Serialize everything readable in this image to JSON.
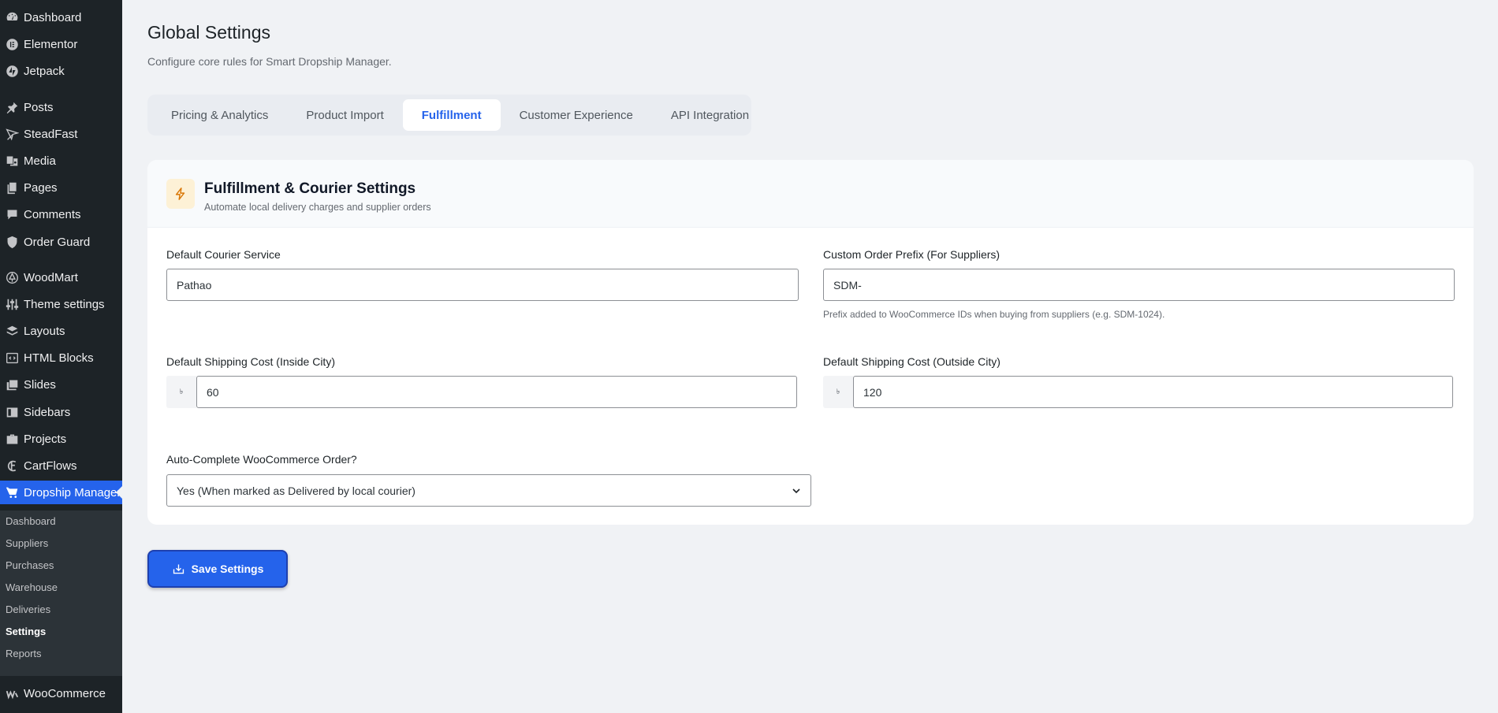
{
  "sidebar": {
    "items": [
      {
        "label": "Dashboard",
        "icon": "dashboard-icon"
      },
      {
        "label": "Elementor",
        "icon": "elementor-icon"
      },
      {
        "label": "Jetpack",
        "icon": "jetpack-icon"
      },
      {
        "label": "Posts",
        "icon": "pin-icon"
      },
      {
        "label": "SteadFast",
        "icon": "steadfast-icon"
      },
      {
        "label": "Media",
        "icon": "media-icon"
      },
      {
        "label": "Pages",
        "icon": "pages-icon"
      },
      {
        "label": "Comments",
        "icon": "comment-icon"
      },
      {
        "label": "Order Guard",
        "icon": "shield-icon"
      },
      {
        "label": "WoodMart",
        "icon": "woodmart-icon"
      },
      {
        "label": "Theme settings",
        "icon": "sliders-icon"
      },
      {
        "label": "Layouts",
        "icon": "layers-icon"
      },
      {
        "label": "HTML Blocks",
        "icon": "code-icon"
      },
      {
        "label": "Slides",
        "icon": "slides-icon"
      },
      {
        "label": "Sidebars",
        "icon": "sidebar-icon"
      },
      {
        "label": "Projects",
        "icon": "briefcase-icon"
      },
      {
        "label": "CartFlows",
        "icon": "cartflows-icon"
      },
      {
        "label": "Dropship Manager",
        "icon": "cart-icon"
      },
      {
        "label": "WooCommerce",
        "icon": "woocommerce-icon"
      }
    ],
    "submenu": [
      "Dashboard",
      "Suppliers",
      "Purchases",
      "Warehouse",
      "Deliveries",
      "Settings",
      "Reports"
    ],
    "active_color": "#2563eb"
  },
  "page": {
    "title": "Global Settings",
    "subtitle": "Configure core rules for Smart Dropship Manager."
  },
  "tabs": [
    "Pricing & Analytics",
    "Product Import",
    "Fulfillment",
    "Customer Experience",
    "API Integration"
  ],
  "active_tab": "Fulfillment",
  "card": {
    "title": "Fulfillment & Courier Settings",
    "description": "Automate local delivery charges and supplier orders",
    "icon": "lightning-icon"
  },
  "fields": {
    "courier": {
      "label": "Default Courier Service",
      "value": "Pathao"
    },
    "prefix": {
      "label": "Custom Order Prefix (For Suppliers)",
      "value": "SDM-",
      "help": "Prefix added to WooCommerce IDs when buying from suppliers (e.g. SDM-1024)."
    },
    "inside_city": {
      "label": "Default Shipping Cost (Inside City)",
      "currency": "৳",
      "value": "60"
    },
    "outside_city": {
      "label": "Default Shipping Cost (Outside City)",
      "currency": "৳",
      "value": "120"
    },
    "auto_complete": {
      "label": "Auto-Complete WooCommerce Order?",
      "value": "Yes (When marked as Delivered by local courier)"
    }
  },
  "save_label": "Save Settings"
}
